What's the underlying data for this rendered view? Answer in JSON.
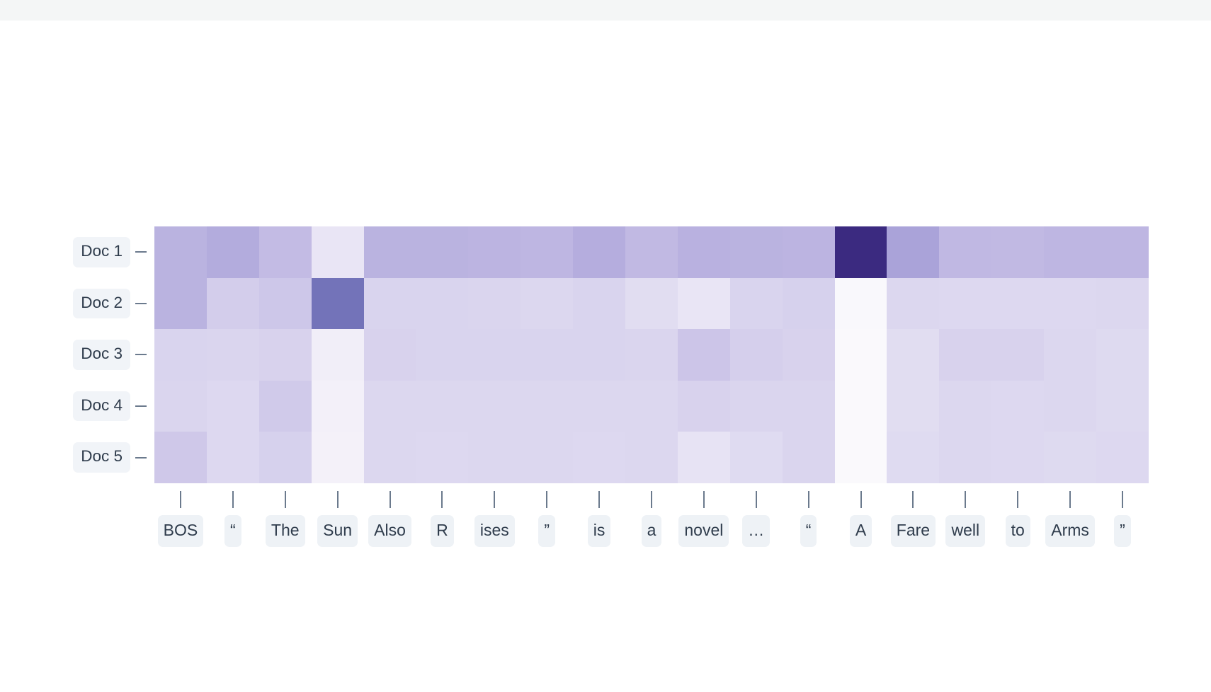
{
  "figure": {
    "background": "#ffffff",
    "top_strip_color": "#f4f6f6"
  },
  "axes": {
    "row_label_chip_bg": "#f1f4f8",
    "col_label_chip_bg": "#eef2f6",
    "label_text_color": "#2f3c4c",
    "tick_color": "#6b7a8d"
  },
  "chart_data": {
    "type": "heatmap",
    "title": "",
    "xlabel": "",
    "ylabel": "",
    "colormap": "Purples",
    "colormap_low": "#f7f4fb",
    "colormap_high": "#3b2a80",
    "grid": false,
    "legend": "none",
    "vmin": 0.0,
    "vmax": 1.0,
    "row_labels": [
      "Doc 1",
      "Doc 2",
      "Doc 3",
      "Doc 4",
      "Doc 5"
    ],
    "categories": [
      "BOS",
      "“",
      "The",
      "Sun",
      "Also",
      "R",
      "ises",
      "”",
      "is",
      "a",
      "novel",
      "…",
      "“",
      "A",
      "Fare",
      "well",
      "to",
      "Arms",
      "”"
    ],
    "series": [
      {
        "name": "Doc 1",
        "values": [
          0.47,
          0.51,
          0.42,
          0.16,
          0.47,
          0.47,
          0.46,
          0.45,
          0.5,
          0.43,
          0.48,
          0.47,
          0.46,
          1.0,
          0.56,
          0.44,
          0.43,
          0.45,
          0.45
        ]
      },
      {
        "name": "Doc 2",
        "values": [
          0.47,
          0.31,
          0.35,
          0.78,
          0.27,
          0.27,
          0.26,
          0.25,
          0.27,
          0.21,
          0.16,
          0.27,
          0.29,
          0.03,
          0.25,
          0.24,
          0.24,
          0.24,
          0.25
        ]
      },
      {
        "name": "Doc 3",
        "values": [
          0.27,
          0.26,
          0.28,
          0.11,
          0.28,
          0.27,
          0.27,
          0.27,
          0.27,
          0.26,
          0.36,
          0.3,
          0.28,
          0.02,
          0.21,
          0.28,
          0.28,
          0.25,
          0.23
        ]
      },
      {
        "name": "Doc 4",
        "values": [
          0.26,
          0.24,
          0.33,
          0.1,
          0.25,
          0.25,
          0.25,
          0.25,
          0.25,
          0.25,
          0.28,
          0.26,
          0.26,
          0.02,
          0.21,
          0.25,
          0.24,
          0.25,
          0.23
        ]
      },
      {
        "name": "Doc 5",
        "values": [
          0.34,
          0.24,
          0.29,
          0.09,
          0.25,
          0.24,
          0.25,
          0.25,
          0.24,
          0.25,
          0.17,
          0.22,
          0.26,
          0.02,
          0.22,
          0.25,
          0.24,
          0.23,
          0.24
        ]
      }
    ]
  }
}
